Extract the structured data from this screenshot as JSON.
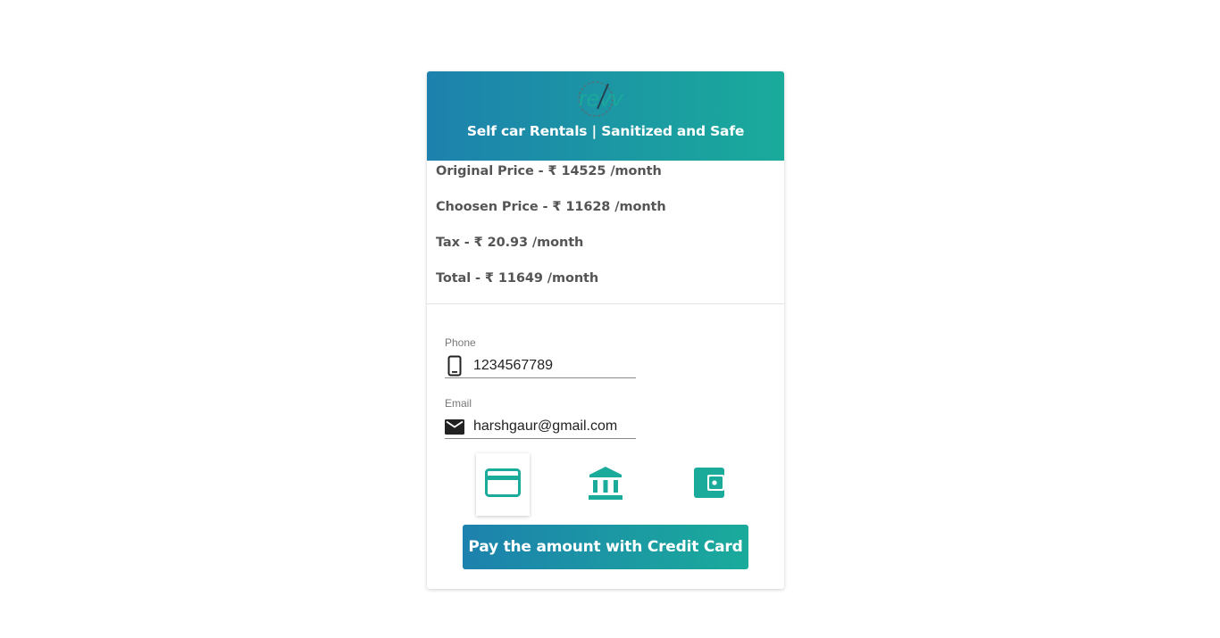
{
  "header": {
    "title": "Self car Rentals | Sanitized and Safe",
    "logo_text": "revv"
  },
  "pricing": {
    "original": "Original Price - ₹ 14525 /month",
    "chosen": "Choosen Price - ₹ 11628 /month",
    "tax": "Tax - ₹ 20.93 /month",
    "total": "Total - ₹ 11649 /month"
  },
  "form": {
    "phone": {
      "label": "Phone",
      "value": "1234567789",
      "icon": "phone-icon"
    },
    "email": {
      "label": "Email",
      "value": "harshgaur@gmail.com",
      "icon": "mail-icon"
    }
  },
  "payment_methods": [
    {
      "name": "Credit Card",
      "icon": "credit-card-icon",
      "selected": true
    },
    {
      "name": "Bank",
      "icon": "bank-icon",
      "selected": false
    },
    {
      "name": "Wallet",
      "icon": "wallet-icon",
      "selected": false
    }
  ],
  "pay_button": {
    "label": "Pay the amount with Credit Card"
  },
  "colors": {
    "gradient_start": "#1d81ad",
    "gradient_end": "#1aab9b",
    "accent": "#1aab9b"
  }
}
